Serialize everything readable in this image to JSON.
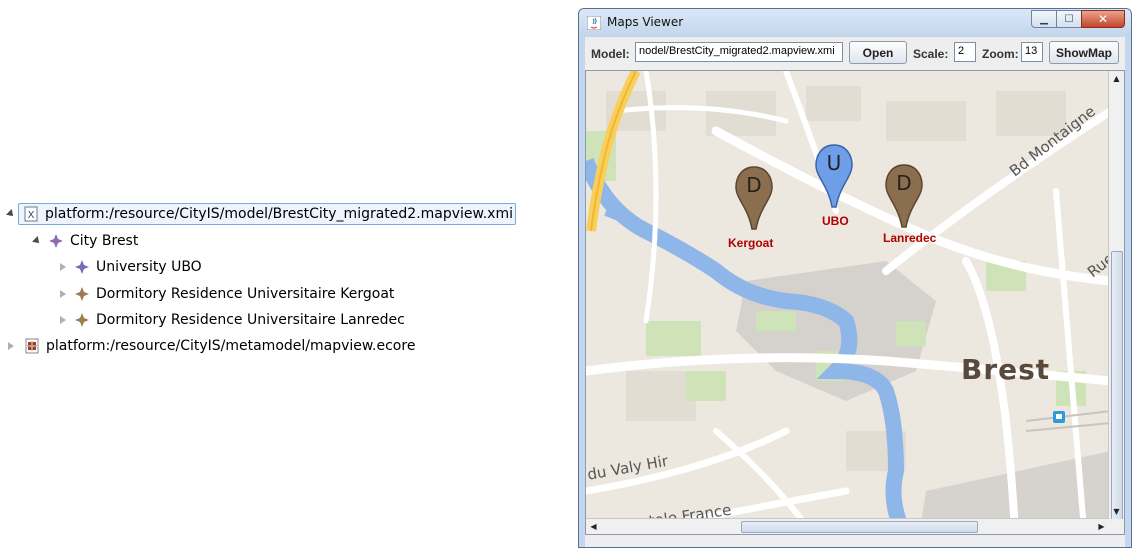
{
  "tree": {
    "root1": {
      "label": "platform:/resource/CityIS/model/BrestCity_migrated2.mapview.xmi",
      "icon": "xmi-file-icon"
    },
    "city": {
      "label": "City Brest"
    },
    "children": [
      {
        "label": "University UBO",
        "color": "#7a6bb5"
      },
      {
        "label": "Dormitory Residence Universitaire Kergoat",
        "color": "#a07a50"
      },
      {
        "label": "Dormitory Residence Universitaire Lanredec",
        "color": "#a07a50"
      }
    ],
    "root2": {
      "label": "platform:/resource/CityIS/metamodel/mapview.ecore",
      "icon": "ecore-file-icon"
    }
  },
  "window": {
    "title": "Maps Viewer",
    "controls": {
      "minimize": "▁",
      "maximize": "☐",
      "close": "✕"
    }
  },
  "toolbar": {
    "model_label": "Model:",
    "model_value": "nodel/BrestCity_migrated2.mapview.xmi",
    "open_button": "Open",
    "scale_label": "Scale:",
    "scale_value": "2",
    "zoom_label": "Zoom:",
    "zoom_value": "13",
    "showmap_button": "ShowMap"
  },
  "map": {
    "city_label": "Brest",
    "street_labels": [
      "Bd Montaigne",
      "Rue",
      "du Valy Hir",
      "Rue Anatole France"
    ],
    "markers": [
      {
        "letter": "D",
        "label": "Kergoat",
        "color": "#8b6e4e"
      },
      {
        "letter": "U",
        "label": "UBO",
        "color": "#6f9ee8"
      },
      {
        "letter": "D",
        "label": "Lanredec",
        "color": "#8b6e4e"
      }
    ],
    "marker_label_color": "#b00000"
  }
}
